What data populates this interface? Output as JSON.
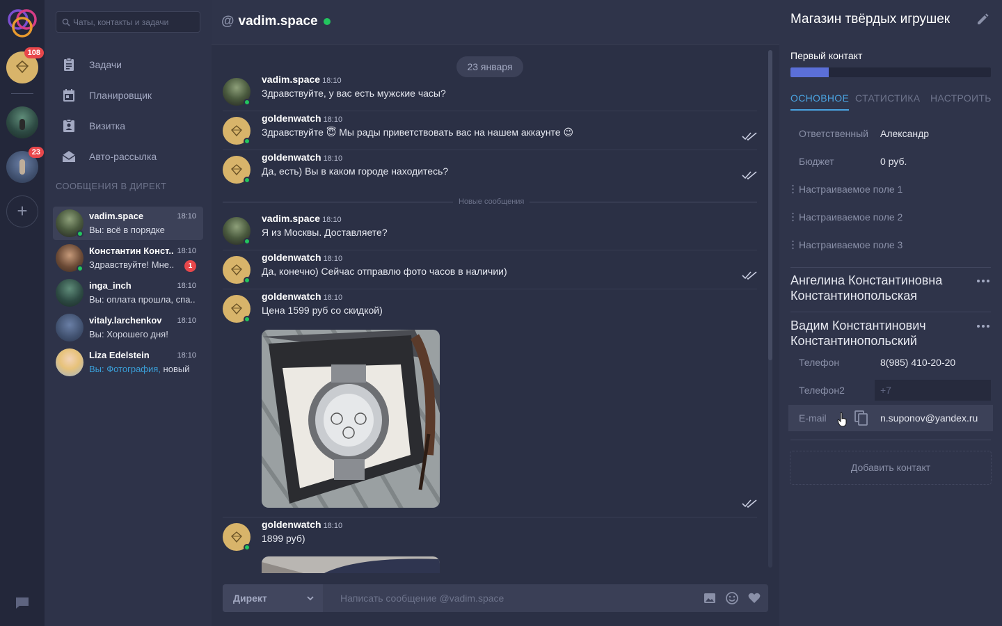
{
  "rail": {
    "accounts": [
      {
        "name": "account-goldenwatch",
        "badge": "108"
      },
      {
        "name": "account-2",
        "badge": ""
      },
      {
        "name": "account-3",
        "badge": "23"
      }
    ],
    "add_label": "+"
  },
  "sidebar": {
    "search_placeholder": "Чаты, контакты и задачи",
    "menu": [
      {
        "label": "Задачи",
        "icon": "clipboard-icon"
      },
      {
        "label": "Планировщик",
        "icon": "calendar-icon"
      },
      {
        "label": "Визитка",
        "icon": "badge-icon"
      },
      {
        "label": "Авто-рассылка",
        "icon": "mail-icon"
      }
    ],
    "section_title": "СООБЩЕНИЯ В ДИРЕКТ",
    "dialogs": [
      {
        "name": "vadim.space",
        "time": "18:10",
        "preview_prefix": "",
        "preview": "Вы: всё в порядке",
        "unread": "",
        "online": true,
        "active": true
      },
      {
        "name": "Константин Конст..",
        "time": "18:10",
        "preview_prefix": "",
        "preview": "Здравствуйте! Мне..",
        "unread": "1",
        "online": true,
        "active": false
      },
      {
        "name": "inga_inch",
        "time": "18:10",
        "preview_prefix": "",
        "preview": "Вы: оплата прошла, спа..",
        "unread": "",
        "online": false,
        "active": false
      },
      {
        "name": "vitaly.larchenkov",
        "time": "18:10",
        "preview_prefix": "",
        "preview": "Вы: Хорошего дня!",
        "unread": "",
        "online": false,
        "active": false
      },
      {
        "name": "Liza Edelstein",
        "time": "18:10",
        "preview_prefix": "Вы: Фотография,",
        "preview": " новый",
        "unread": "",
        "online": false,
        "active": false
      }
    ]
  },
  "chat": {
    "title_prefix": "@",
    "title": "vadim.space",
    "date": "23 января",
    "new_messages_label": "Новые сообщения",
    "messages": [
      {
        "author": "vadim.space",
        "time": "18:10",
        "text": "Здравствуйте, у вас есть мужские часы?",
        "read": false
      },
      {
        "author": "goldenwatch",
        "time": "18:10",
        "text": "Здравствуйте 😇 Мы рады приветствовать вас на нашем аккаунте 😉",
        "read": true
      },
      {
        "author": "goldenwatch",
        "time": "18:10",
        "text": "Да, есть) Вы в каком городе находитесь?",
        "read": true
      },
      {
        "author": "vadim.space",
        "time": "18:10",
        "text": "Я из Москвы. Доставляете?",
        "read": false
      },
      {
        "author": "goldenwatch",
        "time": "18:10",
        "text": "Да, конечно) Сейчас отправлю фото часов в наличии)",
        "read": true
      },
      {
        "author": "goldenwatch",
        "time": "18:10",
        "text": "Цена 1599 руб со скидкой)",
        "read": true
      },
      {
        "author": "goldenwatch",
        "time": "18:10",
        "text": "1899 руб)",
        "read": false
      }
    ],
    "composer": {
      "channel": "Директ",
      "placeholder": "Написать сообщение @vadim.space"
    }
  },
  "details": {
    "title": "Магазин твёрдых игрушек",
    "stage": "Первый контакт",
    "stage_progress": 0.19,
    "tabs": [
      "ОСНОВНОЕ",
      "СТАТИСТИКА",
      "НАСТРОИТЬ"
    ],
    "fields": [
      {
        "label": "Ответственный",
        "value": "Александр"
      },
      {
        "label": "Бюджет",
        "value": "0 руб."
      },
      {
        "label": "Настраиваемое поле 1",
        "value": ""
      },
      {
        "label": "Настраиваемое поле 2",
        "value": ""
      },
      {
        "label": "Настраиваемое поле 3",
        "value": ""
      }
    ],
    "contacts": [
      {
        "name": "Ангелина Константиновна Константинопольская"
      },
      {
        "name": "Вадим Константинович Константинопольский",
        "phone_label": "Телефон",
        "phone": "8(985) 410-20-20",
        "phone2_label": "Телефон2",
        "phone2_placeholder": "+7",
        "email_label": "E-mail",
        "email": "n.suponov@yandex.ru"
      }
    ],
    "add_contact": "Добавить контакт"
  },
  "colors": {
    "accent": "#4aa3e0",
    "online": "#22c55e",
    "badge": "#e8474b",
    "progress": "#5b6fd8"
  }
}
